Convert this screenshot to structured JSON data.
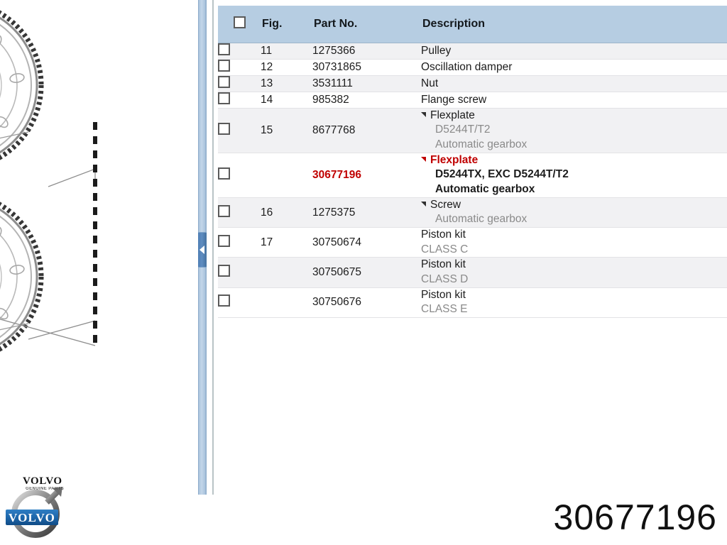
{
  "table": {
    "headers": {
      "checkbox": "",
      "fig": "Fig.",
      "part_no": "Part No.",
      "description": "Description"
    },
    "rows": [
      {
        "fig": "11",
        "part_no": "1275366",
        "desc_main": "Pulley",
        "desc_sub": "",
        "desc_sub2": "",
        "grouped": false,
        "highlight": false
      },
      {
        "fig": "12",
        "part_no": "30731865",
        "desc_main": "Oscillation damper",
        "desc_sub": "",
        "desc_sub2": "",
        "grouped": false,
        "highlight": false
      },
      {
        "fig": "13",
        "part_no": "3531111",
        "desc_main": "Nut",
        "desc_sub": "",
        "desc_sub2": "",
        "grouped": false,
        "highlight": false
      },
      {
        "fig": "14",
        "part_no": "985382",
        "desc_main": "Flange screw",
        "desc_sub": "",
        "desc_sub2": "",
        "grouped": false,
        "highlight": false
      },
      {
        "fig": "15",
        "part_no": "8677768",
        "desc_main": "Flexplate",
        "desc_sub": "D5244T/T2",
        "desc_sub2": "Automatic gearbox",
        "grouped": true,
        "highlight": false
      },
      {
        "fig": "",
        "part_no": "30677196",
        "desc_main": "Flexplate",
        "desc_sub": "D5244TX, EXC D5244T/T2",
        "desc_sub2": "Automatic gearbox",
        "grouped": true,
        "highlight": true
      },
      {
        "fig": "16",
        "part_no": "1275375",
        "desc_main": "Screw",
        "desc_sub": "Automatic gearbox",
        "desc_sub2": "",
        "grouped": true,
        "highlight": false
      },
      {
        "fig": "17",
        "part_no": "30750674",
        "desc_main": "Piston kit",
        "desc_sub": "CLASS C",
        "desc_sub2": "",
        "grouped": false,
        "highlight": false
      },
      {
        "fig": "",
        "part_no": "30750675",
        "desc_main": "Piston kit",
        "desc_sub": "CLASS D",
        "desc_sub2": "",
        "grouped": false,
        "highlight": false
      },
      {
        "fig": "",
        "part_no": "30750676",
        "desc_main": "Piston kit",
        "desc_sub": "CLASS E",
        "desc_sub2": "",
        "grouped": false,
        "highlight": false
      }
    ]
  },
  "splitter": {
    "collapse_icon": "left-triangle"
  },
  "logo": {
    "wordmark": "VOLVO",
    "sub_wordmark": "GENUINE PARTS",
    "badge_text": "VOLVO"
  },
  "footer": {
    "part_number": "30677196"
  },
  "colors": {
    "header_blue": "#b6cde2",
    "row_alt": "#f1f1f3",
    "row_plain": "#ffffff",
    "highlight_red": "#c00000",
    "sub_text_gray": "#8a8a8a",
    "splitter_blue": "#a9c3dc",
    "logo_badge_blue": "#1c64a8"
  },
  "diagram": {
    "alt": "Exploded flexplate / flywheel ring-gear drawing with dashed leader line"
  }
}
